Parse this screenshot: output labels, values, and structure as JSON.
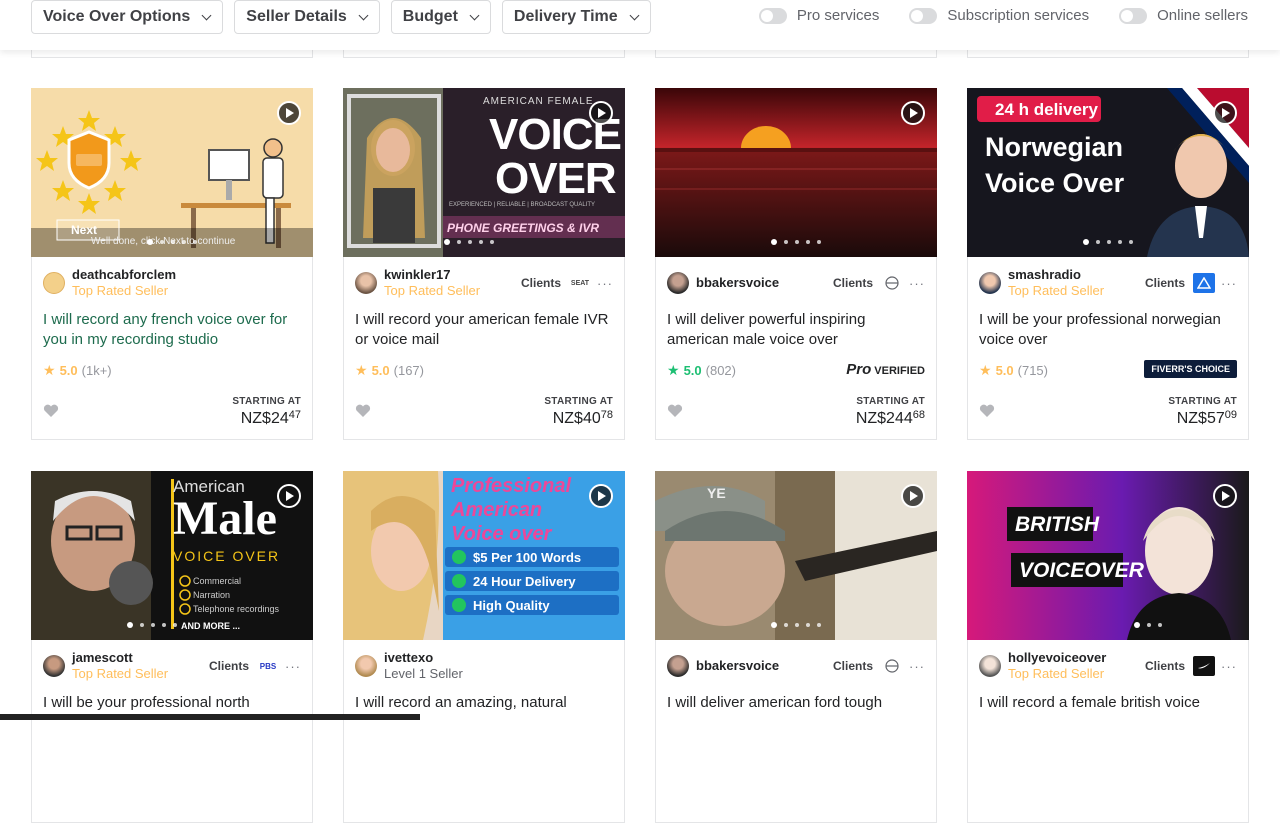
{
  "filters": [
    {
      "label": "Voice Over Options"
    },
    {
      "label": "Seller Details"
    },
    {
      "label": "Budget"
    },
    {
      "label": "Delivery Time"
    }
  ],
  "toggles": [
    {
      "label": "Pro services"
    },
    {
      "label": "Subscription services"
    },
    {
      "label": "Online sellers"
    }
  ],
  "cards": [
    {
      "seller": "deathcabforclem",
      "level": "Top Rated Seller",
      "title": "I will record any french voice over for you in my recording studio",
      "score": "5.0",
      "count": "(1k+)",
      "price_label": "STARTING AT",
      "price_main": "NZ$24",
      "price_cents": "47",
      "thumb_caption": "Well done, click Next to continue",
      "thumb_next": "Next"
    },
    {
      "seller": "kwinkler17",
      "level": "Top Rated Seller",
      "clients": "Clients",
      "title": "I will record your american female IVR or voice mail",
      "score": "5.0",
      "count": "(167)",
      "price_label": "STARTING AT",
      "price_main": "NZ$40",
      "price_cents": "78",
      "thumb_line1": "AMERICAN FEMALE",
      "thumb_line2": "VOICE",
      "thumb_line3": "OVER",
      "thumb_line4": "EXPERIENCED | RELIABLE | BROADCAST QUALITY",
      "thumb_line5": "PHONE GREETINGS & IVR"
    },
    {
      "seller": "bbakersvoice",
      "clients": "Clients",
      "title": "I will deliver powerful inspiring american male voice over",
      "score": "5.0",
      "count": "(802)",
      "pro_word": "Pro",
      "pro_verified": "VERIFIED",
      "price_label": "STARTING AT",
      "price_main": "NZ$244",
      "price_cents": "68"
    },
    {
      "seller": "smashradio",
      "level": "Top Rated Seller",
      "clients": "Clients",
      "title": "I will be your professional norwegian voice over",
      "score": "5.0",
      "count": "(715)",
      "choice": "FIVERR'S CHOICE",
      "price_label": "STARTING AT",
      "price_main": "NZ$57",
      "price_cents": "09",
      "thumb_line1": "24 h delivery",
      "thumb_line2": "Norwegian",
      "thumb_line3": "Voice Over"
    },
    {
      "seller": "jamescott",
      "level": "Top Rated Seller",
      "clients": "Clients",
      "title": "I will be your professional north",
      "thumb_line1": "American",
      "thumb_line2": "Male",
      "thumb_line3": "VOICE OVER",
      "thumb_items": [
        "Commercial",
        "Narration",
        "Telephone recordings"
      ],
      "thumb_more": "AND MORE ..."
    },
    {
      "seller": "ivettexo",
      "level": "Level 1 Seller",
      "title": "I will record an amazing, natural",
      "thumb_lines": [
        "Professional",
        "American",
        "Voice over"
      ],
      "thumb_checks": [
        "$5 Per 100 Words",
        "24 Hour Delivery",
        "High Quality"
      ]
    },
    {
      "seller": "bbakersvoice",
      "clients": "Clients",
      "title": "I will deliver american ford tough",
      "thumb_text": "YE"
    },
    {
      "seller": "hollyevoiceover",
      "level": "Top Rated Seller",
      "clients": "Clients",
      "title": "I will record a female british voice",
      "thumb_line1": "BRITISH",
      "thumb_line2": "VOICEOVER"
    }
  ],
  "client_logos": {
    "c2": "SEAT",
    "c5": "PBS"
  },
  "icons": {
    "heart": "heart-icon",
    "play": "play-icon",
    "star": "star-icon",
    "more": "more-dots-icon"
  },
  "colors": {
    "top_rated": "#ffbe5b",
    "green": "#1dbf73",
    "choice_bg": "#0d1d3a"
  }
}
